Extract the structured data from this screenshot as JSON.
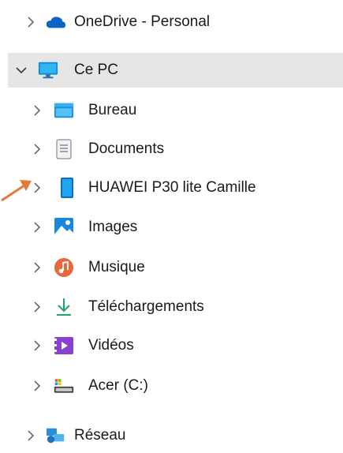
{
  "tree": {
    "items": [
      {
        "label": "OneDrive - Personal",
        "icon": "onedrive-cloud-icon",
        "state": "collapsed"
      },
      {
        "label": "Ce PC",
        "icon": "this-pc-monitor-icon",
        "state": "expanded",
        "selected": true
      },
      {
        "label": "Bureau",
        "icon": "desktop-folder-icon",
        "state": "collapsed"
      },
      {
        "label": "Documents",
        "icon": "documents-icon",
        "state": "collapsed"
      },
      {
        "label": "HUAWEI P30 lite Camille",
        "icon": "phone-device-icon",
        "state": "collapsed"
      },
      {
        "label": "Images",
        "icon": "pictures-icon",
        "state": "collapsed"
      },
      {
        "label": "Musique",
        "icon": "music-icon",
        "state": "collapsed"
      },
      {
        "label": "Téléchargements",
        "icon": "downloads-icon",
        "state": "collapsed"
      },
      {
        "label": "Vidéos",
        "icon": "videos-icon",
        "state": "collapsed"
      },
      {
        "label": "Acer (C:)",
        "icon": "drive-icon",
        "state": "collapsed"
      },
      {
        "label": "Réseau",
        "icon": "network-icon",
        "state": "collapsed"
      }
    ]
  },
  "annotation": {
    "icon": "orange-pointer-arrow",
    "color": "#e07b39"
  },
  "colors": {
    "selected_bg": "#e6e6e6",
    "chevron": "#5a5a5a",
    "accent_blue": "#0a7fd6"
  }
}
